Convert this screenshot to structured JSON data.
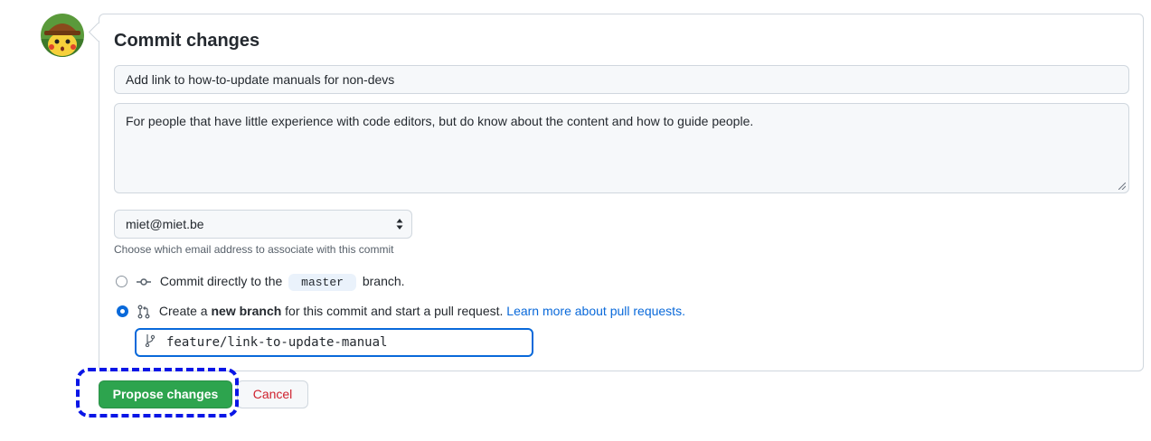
{
  "colors": {
    "primary_button": "#2da44e",
    "link": "#0969da",
    "danger": "#cf222e",
    "highlight": "#0a16e6"
  },
  "avatar": {
    "icon": "pikachu-detective-avatar"
  },
  "commit": {
    "title": "Commit changes",
    "summary_value": "Add link to how-to-update manuals for non-devs",
    "description_value": "For people that have little experience with code editors, but do know about the content and how to guide people.",
    "email_selected": "miet@miet.be",
    "email_help": "Choose which email address to associate with this commit"
  },
  "options": {
    "direct": {
      "label_prefix": "Commit directly to the",
      "branch": "master",
      "label_suffix": "branch.",
      "checked": false,
      "icon": "git-commit-icon"
    },
    "new_branch": {
      "label_prefix": "Create a",
      "label_bold": "new branch",
      "label_suffix": "for this commit and start a pull request.",
      "link": "Learn more about pull requests.",
      "checked": true,
      "icon": "git-pull-request-icon"
    }
  },
  "branch_name_value": "feature/link-to-update-manual",
  "buttons": {
    "propose": "Propose changes",
    "cancel": "Cancel"
  }
}
